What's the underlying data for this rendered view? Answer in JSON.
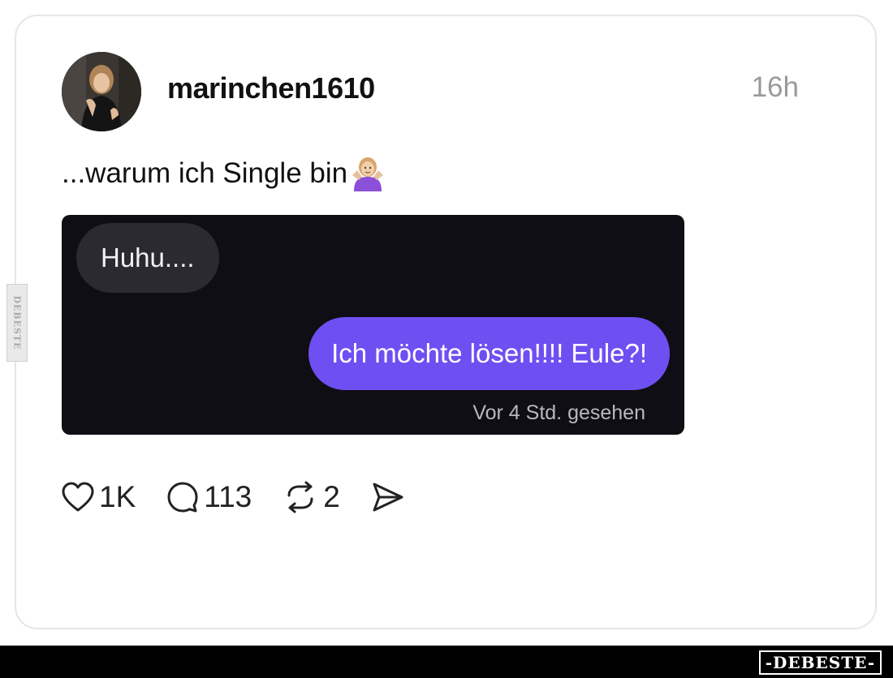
{
  "post": {
    "username": "marinchen1610",
    "timestamp": "16h",
    "caption": "...warum ich Single bin",
    "emoji": "person-shrugging-emoji"
  },
  "embedded_chat": {
    "incoming_message": "Huhu....",
    "outgoing_message": "Ich möchte lösen!!!! Eule?!",
    "seen_status": "Vor 4 Std. gesehen",
    "colors": {
      "background": "#0f0e14",
      "incoming_bubble": "#2b2a31",
      "outgoing_bubble": "#6e4ff2"
    }
  },
  "actions": {
    "likes": "1K",
    "comments": "113",
    "reposts": "2",
    "icons": [
      "heart-icon",
      "comment-icon",
      "repost-icon",
      "share-icon"
    ]
  },
  "watermark": {
    "side_text": "DEBESTE",
    "footer_logo": "-DEBESTE-"
  }
}
